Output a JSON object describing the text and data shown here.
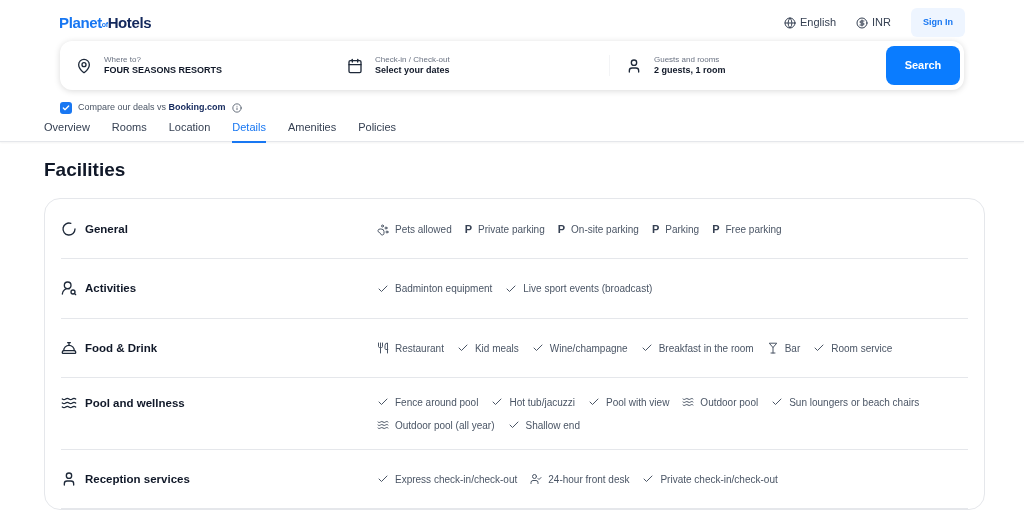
{
  "header": {
    "logo": {
      "first": "Planet",
      "middle": "of",
      "last": "Hotels"
    },
    "language": "English",
    "currency": "INR",
    "sign_in": "Sign In"
  },
  "search_bar": {
    "destination": {
      "label": "Where to?",
      "value": "FOUR SEASONS RESORTS"
    },
    "dates": {
      "label": "Check-in / Check-out",
      "value": "Select your dates"
    },
    "guests": {
      "label": "Guests and rooms",
      "value": "2 guests, 1 room"
    },
    "button": "Search"
  },
  "compare": {
    "checked": true,
    "text": "Compare our deals vs",
    "brand": "Booking.com"
  },
  "tabs": [
    {
      "label": "Overview",
      "selected": false
    },
    {
      "label": "Rooms",
      "selected": false
    },
    {
      "label": "Location",
      "selected": false
    },
    {
      "label": "Details",
      "selected": true
    },
    {
      "label": "Amenities",
      "selected": false
    },
    {
      "label": "Policies",
      "selected": false
    }
  ],
  "facilities": {
    "title": "Facilities",
    "sections": [
      {
        "kind": "general",
        "name": "General",
        "items": [
          {
            "kind": "paw",
            "label": "Pets allowed"
          },
          {
            "kind": "parking",
            "glyph": "P",
            "label": "Private parking"
          },
          {
            "kind": "parking",
            "glyph": "P",
            "label": "On-site parking"
          },
          {
            "kind": "parking",
            "glyph": "P",
            "label": "Parking"
          },
          {
            "kind": "parking",
            "glyph": "P",
            "label": "Free parking"
          }
        ]
      },
      {
        "kind": "activities",
        "name": "Activities",
        "items": [
          {
            "kind": "check",
            "label": "Badminton equipment"
          },
          {
            "kind": "check",
            "label": "Live sport events (broadcast)"
          }
        ]
      },
      {
        "kind": "food",
        "name": "Food & Drink",
        "items": [
          {
            "kind": "cutlery",
            "label": "Restaurant"
          },
          {
            "kind": "check",
            "label": "Kid meals"
          },
          {
            "kind": "check",
            "label": "Wine/champagne"
          },
          {
            "kind": "check",
            "label": "Breakfast in the room"
          },
          {
            "kind": "cocktail",
            "label": "Bar"
          },
          {
            "kind": "check",
            "label": "Room service"
          }
        ]
      },
      {
        "kind": "pool",
        "name": "Pool and wellness",
        "items": [
          {
            "kind": "check",
            "label": "Fence around pool"
          },
          {
            "kind": "check",
            "label": "Hot tub/jacuzzi"
          },
          {
            "kind": "check",
            "label": "Pool with view"
          },
          {
            "kind": "swim",
            "label": "Outdoor pool"
          },
          {
            "kind": "check",
            "label": "Sun loungers or beach chairs"
          },
          {
            "kind": "swim",
            "label": "Outdoor pool (all year)"
          },
          {
            "kind": "check",
            "label": "Shallow end"
          }
        ]
      },
      {
        "kind": "reception",
        "name": "Reception services",
        "items": [
          {
            "kind": "check",
            "label": "Express check-in/check-out"
          },
          {
            "kind": "desk",
            "label": "24-hour front desk"
          },
          {
            "kind": "check",
            "label": "Private check-in/check-out"
          }
        ]
      }
    ]
  }
}
